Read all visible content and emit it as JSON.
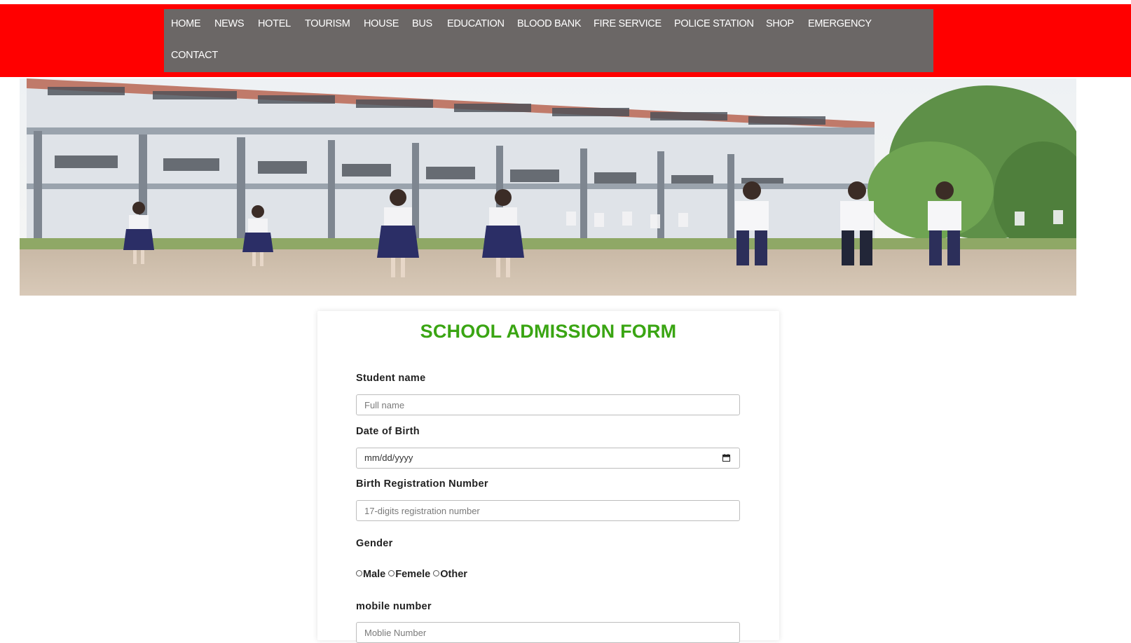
{
  "nav": {
    "items": [
      {
        "label": "HOME"
      },
      {
        "label": "NEWS"
      },
      {
        "label": "HOTEL"
      },
      {
        "label": "TOURISM"
      },
      {
        "label": "HOUSE"
      },
      {
        "label": "BUS"
      },
      {
        "label": "EDUCATION"
      },
      {
        "label": "BLOOD BANK"
      },
      {
        "label": "FIRE SERVICE"
      },
      {
        "label": "POLICE STATION"
      },
      {
        "label": "SHOP"
      },
      {
        "label": "EMERGENCY"
      },
      {
        "label": "CONTACT"
      }
    ]
  },
  "form": {
    "title": "SCHOOL ADMISSION FORM",
    "student_name_label": "Student name",
    "student_name_placeholder": "Full name",
    "dob_label": "Date of Birth",
    "dob_placeholder": "mm/dd/yyyy",
    "birth_reg_label": "Birth Registration Number",
    "birth_reg_placeholder": "17-digits registration number",
    "gender_label": "Gender",
    "gender_options": [
      "Male",
      "Femele",
      "Other"
    ],
    "mobile_label": "mobile number",
    "mobile_placeholder": "Moblie Number"
  },
  "colors": {
    "top_band": "#ff0000",
    "nav_bg": "#6b6766",
    "title": "#3aa513"
  }
}
